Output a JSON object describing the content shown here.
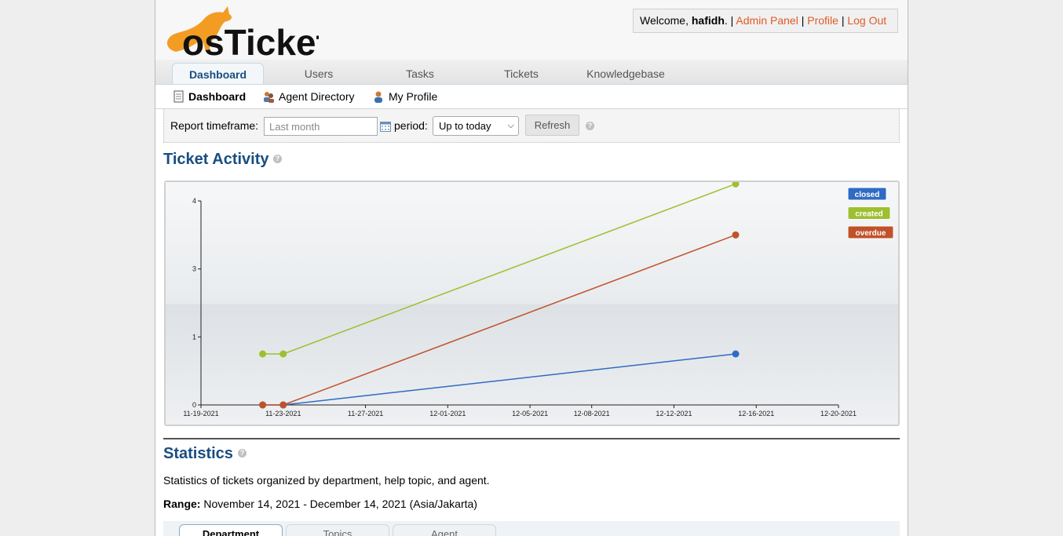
{
  "header": {
    "logo_text": "osTicket",
    "welcome_prefix": "Welcome, ",
    "username": "hafidh",
    "welcome_suffix": ". |",
    "admin_panel": "Admin Panel",
    "profile": "Profile",
    "logout": "Log Out",
    "sep": "|"
  },
  "nav": {
    "tabs": [
      {
        "label": "Dashboard",
        "active": true
      },
      {
        "label": "Users"
      },
      {
        "label": "Tasks"
      },
      {
        "label": "Tickets"
      },
      {
        "label": "Knowledgebase"
      }
    ]
  },
  "subnav": {
    "items": [
      {
        "label": "Dashboard",
        "icon": "dashboard-icon",
        "active": true
      },
      {
        "label": "Agent Directory",
        "icon": "agent-directory-icon"
      },
      {
        "label": "My Profile",
        "icon": "my-profile-icon"
      }
    ]
  },
  "filter": {
    "timeframe_label": "Report timeframe:",
    "timeframe_placeholder": "Last month",
    "period_label": "period:",
    "period_value": "Up to today",
    "refresh_label": "Refresh"
  },
  "ticket_activity": {
    "title": "Ticket Activity"
  },
  "chart_data": {
    "type": "line",
    "title": "",
    "xlabel": "",
    "ylabel": "",
    "x_ticks": [
      "11-19-2021",
      "11-23-2021",
      "11-27-2021",
      "12-01-2021",
      "12-05-2021",
      "12-08-2021",
      "12-12-2021",
      "12-16-2021",
      "12-20-2021"
    ],
    "y_ticks": [
      "0",
      "1",
      "3",
      "4"
    ],
    "grid": false,
    "legend_position": "top-right",
    "series": [
      {
        "name": "closed",
        "color": "#2f6bc4",
        "points": [
          [
            "11-22-2021",
            0
          ],
          [
            "11-23-2021",
            0
          ],
          [
            "12-15-2021",
            0.75
          ]
        ]
      },
      {
        "name": "created",
        "color": "#9ebf2f",
        "points": [
          [
            "11-22-2021",
            0.75
          ],
          [
            "11-23-2021",
            0.75
          ],
          [
            "12-15-2021",
            3.25
          ]
        ]
      },
      {
        "name": "overdue",
        "color": "#c0522b",
        "points": [
          [
            "11-22-2021",
            0
          ],
          [
            "11-23-2021",
            0
          ],
          [
            "12-15-2021",
            2.5
          ]
        ]
      }
    ]
  },
  "statistics": {
    "title": "Statistics",
    "description": "Statistics of tickets organized by department, help topic, and agent.",
    "range_label": "Range:",
    "range_value": " November 14, 2021 - December 14, 2021 (Asia/Jakarta)",
    "tabs": [
      {
        "label": "Department",
        "active": true
      },
      {
        "label": "Topics"
      },
      {
        "label": "Agent"
      }
    ]
  }
}
